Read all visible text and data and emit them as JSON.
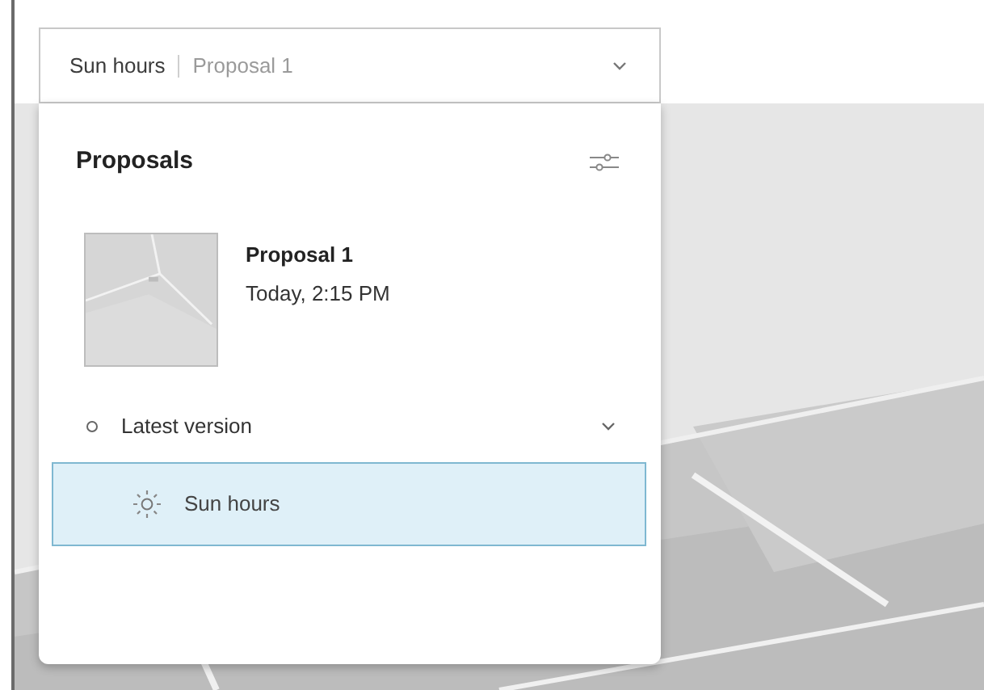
{
  "selector": {
    "analysis": "Sun hours",
    "proposal": "Proposal 1"
  },
  "panel": {
    "title": "Proposals",
    "proposals": [
      {
        "name": "Proposal 1",
        "time": "Today, 2:15 PM"
      }
    ],
    "versions": [
      {
        "label": "Latest version",
        "expanded": true,
        "analyses": [
          {
            "label": "Sun hours",
            "selected": true
          }
        ]
      }
    ]
  }
}
